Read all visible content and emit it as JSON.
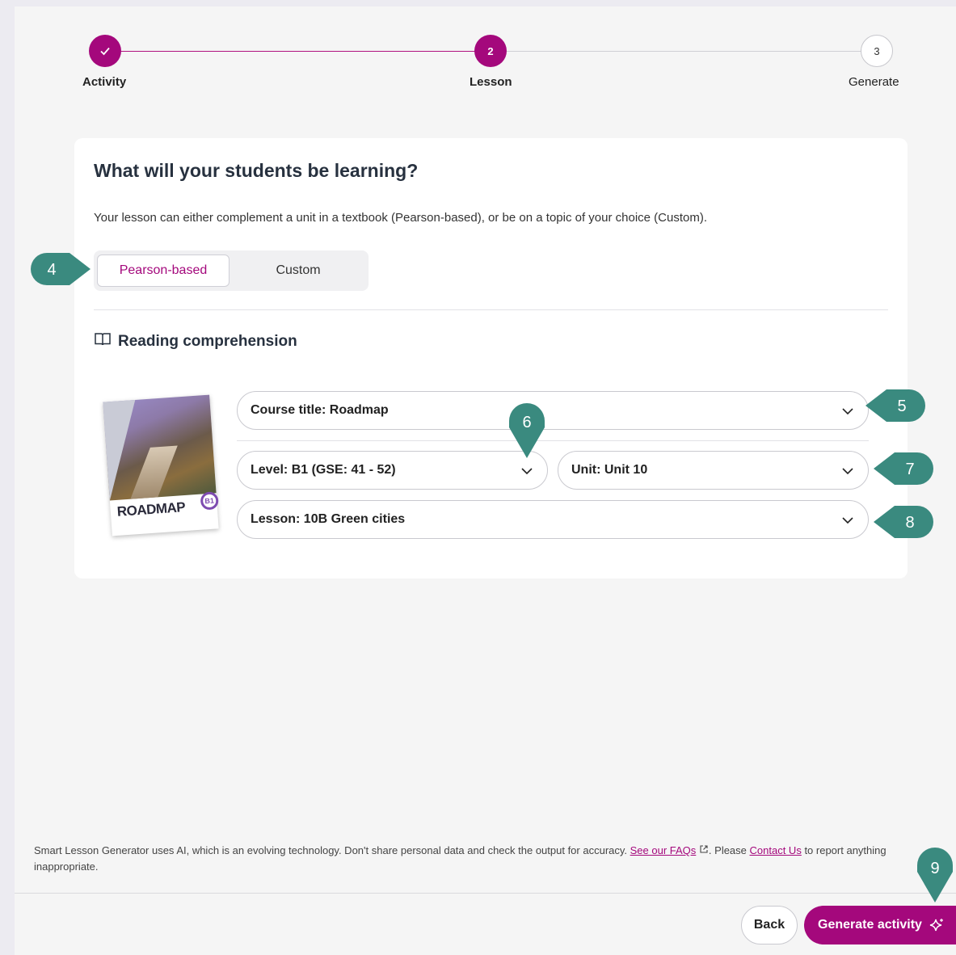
{
  "stepper": {
    "steps": [
      {
        "number": "✓",
        "label": "Activity",
        "state": "done"
      },
      {
        "number": "2",
        "label": "Lesson",
        "state": "active"
      },
      {
        "number": "3",
        "label": "Generate",
        "state": "todo"
      }
    ]
  },
  "card": {
    "title": "What will your students be learning?",
    "description": "Your lesson can either complement a unit in a textbook (Pearson-based), or be on a topic of your choice (Custom).",
    "toggle": {
      "selected": "Pearson-based",
      "options": [
        "Pearson-based",
        "Custom"
      ]
    },
    "section_title": "Reading comprehension",
    "cover": {
      "brand": "ROADMAP",
      "level": "B1"
    },
    "selects": {
      "course": "Course title: Roadmap",
      "level": "Level: B1 (GSE: 41 - 52)",
      "unit": "Unit: Unit 10",
      "lesson": "Lesson: 10B Green cities"
    }
  },
  "footer": {
    "disclaimer_pre": "Smart Lesson Generator uses AI, which is an evolving technology. Don't share personal data and check the output for accuracy. ",
    "faq_link": "See our FAQs",
    "disclaimer_mid": ". Please ",
    "contact_link": "Contact Us",
    "disclaimer_post": " to report anything inappropriate.",
    "back_label": "Back",
    "generate_label": "Generate activity"
  },
  "callouts": [
    "4",
    "5",
    "6",
    "7",
    "8",
    "9"
  ],
  "colors": {
    "accent": "#a4087c",
    "callout": "#3a8a7f"
  }
}
